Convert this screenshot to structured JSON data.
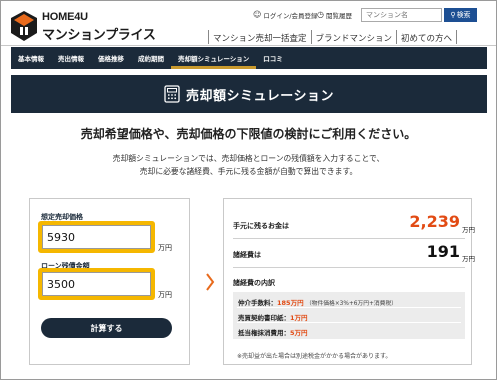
{
  "header": {
    "logo_top": "HOME4U",
    "logo_bottom": "マンションプライス",
    "login_link": "ログイン/会員登録",
    "history_link": "閲覧履歴",
    "search_placeholder": "マンション名",
    "search_button": "検索",
    "nav": [
      "マンション売却一括査定",
      "ブランドマンション",
      "初めての方へ"
    ]
  },
  "subnav": {
    "items": [
      "基本情報",
      "売出情報",
      "価格推移",
      "成約期間",
      "売却額シミュレーション",
      "口コミ"
    ],
    "active_index": 4
  },
  "banner": {
    "title": "売却額シミュレーション",
    "icon": "calculator-icon"
  },
  "intro": {
    "lead": "売却希望価格や、売却価格の下限値の検討にご利用ください。",
    "desc_line1": "売却額シミュレーションでは、売却価格とローンの残債額を入力することで、",
    "desc_line2": "売却に必要な諸経費、手元に残る金額が自動で算出できます。"
  },
  "form": {
    "price_label": "想定売却価格",
    "price_value": "5930",
    "price_unit": "万円",
    "loan_label": "ローン残債金額",
    "loan_value": "3500",
    "loan_unit": "万円",
    "submit": "計算する"
  },
  "result": {
    "remaining_label": "手元に残るお金は",
    "remaining_value": "2,239",
    "remaining_unit": "万円",
    "expenses_label": "諸経費は",
    "expenses_value": "191",
    "expenses_unit": "万円",
    "breakdown_title": "諸経費の内訳",
    "breakdown": [
      {
        "label": "仲介手数料：",
        "value": "185万円",
        "note": "（物件価格×3%+6万円+消費税）"
      },
      {
        "label": "売買契約書印紙：",
        "value": "1万円",
        "note": ""
      },
      {
        "label": "抵当権抹消費用：",
        "value": "5万円",
        "note": ""
      }
    ],
    "footnote": "※売却益が出た場合は別途税金がかかる場合があります。"
  },
  "colors": {
    "navy": "#1b2a3a",
    "accent_gold": "#c99a2e",
    "highlight_yellow": "#f5b700",
    "orange": "#e24b14",
    "search_blue": "#1d4f93"
  }
}
